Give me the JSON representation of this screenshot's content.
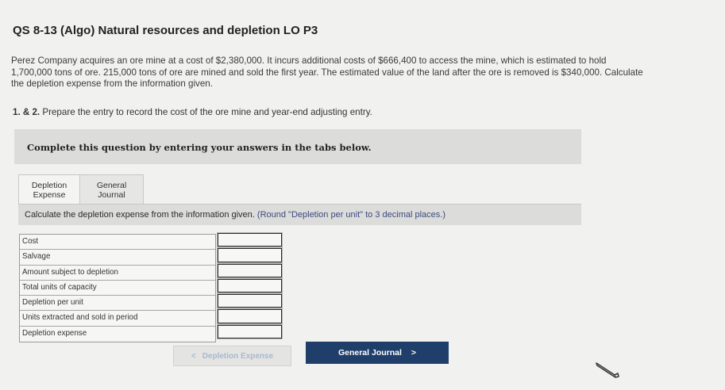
{
  "header": {
    "title": "QS 8-13 (Algo) Natural resources and depletion LO P3"
  },
  "problem": {
    "description": "Perez Company acquires an ore mine at a cost of $2,380,000. It incurs additional costs of $666,400 to access the mine, which is estimated to hold 1,700,000 tons of ore. 215,000 tons of ore are mined and sold the first year. The estimated value of the land after the ore is removed is $340,000. Calculate the depletion expense from the information given.",
    "part_number": "1. & 2.",
    "part_text": "Prepare the entry to record the cost of the ore mine and year-end adjusting entry."
  },
  "instructions_box": {
    "text": "Complete this question by entering your answers in the tabs below."
  },
  "tabs": [
    {
      "line1": "Depletion",
      "line2": "Expense"
    },
    {
      "line1": "General",
      "line2": "Journal"
    }
  ],
  "prompt": {
    "text": "Calculate the depletion expense from the information given.",
    "note": "(Round \"Depletion per unit\" to 3 decimal places.)"
  },
  "table": {
    "rows": [
      {
        "label": "Cost",
        "value": ""
      },
      {
        "label": "Salvage",
        "value": ""
      },
      {
        "label": "Amount subject to depletion",
        "value": ""
      },
      {
        "label": "Total units of capacity",
        "value": ""
      },
      {
        "label": "Depletion per unit",
        "value": ""
      },
      {
        "label": "Units extracted and sold in period",
        "value": ""
      },
      {
        "label": "Depletion expense",
        "value": ""
      }
    ]
  },
  "nav": {
    "prev_label": "Depletion Expense",
    "prev_arrow": "<",
    "next_label": "General Journal",
    "next_arrow": ">"
  },
  "icons": {
    "pencil": "pencil-icon"
  },
  "colors": {
    "next_button_bg": "#1f3f6a",
    "note_text": "#3a4a80"
  }
}
